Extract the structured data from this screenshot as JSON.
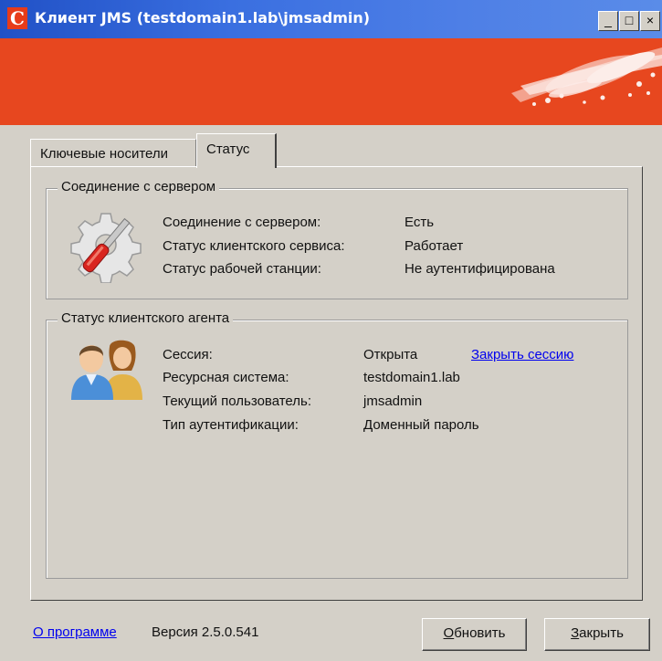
{
  "window": {
    "title": "Клиент JMS (testdomain1.lab\\jmsadmin)",
    "app_icon_letter": "C",
    "minimize_glyph": "_",
    "maximize_glyph": "□",
    "close_glyph": "×",
    "title_bar_color": "#2151c6",
    "banner_color": "#e7471f"
  },
  "tabs": [
    {
      "label": "Ключевые носители",
      "active": false
    },
    {
      "label": "Статус",
      "active": true
    }
  ],
  "server_group": {
    "title": "Соединение с сервером",
    "icon": "gear-screwdriver-icon",
    "rows": [
      {
        "label": "Соединение с сервером:",
        "value": "Есть"
      },
      {
        "label": "Статус клиентского сервиса:",
        "value": "Работает"
      },
      {
        "label": "Статус рабочей станции:",
        "value": "Не аутентифицирована"
      }
    ]
  },
  "agent_group": {
    "title": "Статус клиентского агента",
    "icon": "users-icon",
    "rows": [
      {
        "label": "Сессия:",
        "value": "Открыта"
      },
      {
        "label": "Ресурсная система:",
        "value": "testdomain1.lab"
      },
      {
        "label": "Текущий пользователь:",
        "value": "jmsadmin"
      },
      {
        "label": "Тип аутентификации:",
        "value": "Доменный пароль"
      }
    ],
    "close_session_link": "Закрыть сессию"
  },
  "footer": {
    "about_link": "О программе",
    "version": "Версия 2.5.0.541",
    "refresh_first": "О",
    "refresh_rest": "бновить",
    "close_first": "З",
    "close_rest": "акрыть"
  }
}
